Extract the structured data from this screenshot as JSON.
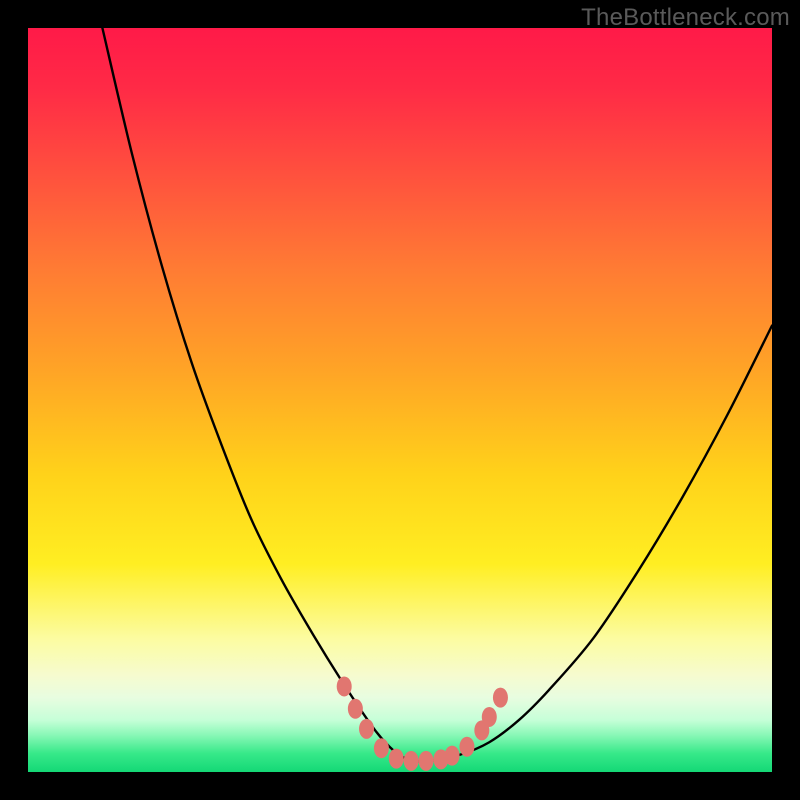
{
  "watermark": "TheBottleneck.com",
  "colors": {
    "frame": "#000000",
    "curve_stroke": "#000000",
    "marker_fill": "#e17670",
    "marker_stroke": "#d85f58"
  },
  "chart_data": {
    "type": "line",
    "title": "",
    "xlabel": "",
    "ylabel": "",
    "xlim": [
      0,
      100
    ],
    "ylim": [
      0,
      100
    ],
    "grid": false,
    "legend": false,
    "note": "Values are percentages of the plot area; (0,0) is bottom-left of the gradient region. Curve is a smooth V reaching ~0 near x≈50, rising steeply to the left (past 100 at x≈10) and moderately to the right (≈60 at x=100). Markers are small salmon dots clustered along the curve near the trough.",
    "series": [
      {
        "name": "curve",
        "x": [
          10,
          14,
          18,
          22,
          26,
          30,
          34,
          38,
          42,
          46,
          48,
          50,
          52,
          54,
          58,
          62,
          66,
          70,
          76,
          82,
          88,
          94,
          100
        ],
        "y": [
          100,
          83,
          68,
          55,
          44,
          34,
          26,
          19,
          12.5,
          6.5,
          4,
          2.2,
          1.5,
          1.5,
          2.3,
          4.0,
          7.0,
          11,
          18,
          27,
          37,
          48,
          60
        ]
      }
    ],
    "markers": [
      {
        "x": 42.5,
        "y": 11.5
      },
      {
        "x": 44.0,
        "y": 8.5
      },
      {
        "x": 45.5,
        "y": 5.8
      },
      {
        "x": 47.5,
        "y": 3.2
      },
      {
        "x": 49.5,
        "y": 1.8
      },
      {
        "x": 51.5,
        "y": 1.5
      },
      {
        "x": 53.5,
        "y": 1.5
      },
      {
        "x": 55.5,
        "y": 1.7
      },
      {
        "x": 57.0,
        "y": 2.2
      },
      {
        "x": 59.0,
        "y": 3.4
      },
      {
        "x": 61.0,
        "y": 5.6
      },
      {
        "x": 62.0,
        "y": 7.4
      },
      {
        "x": 63.5,
        "y": 10.0
      }
    ]
  }
}
